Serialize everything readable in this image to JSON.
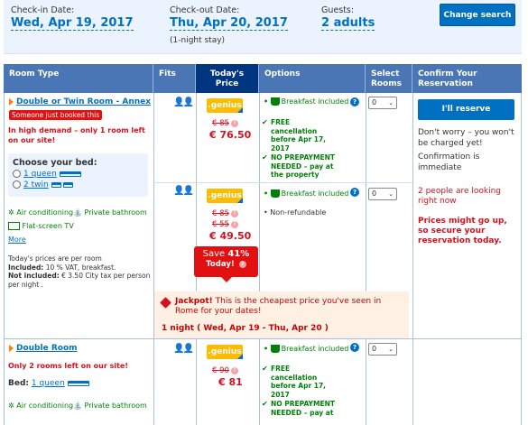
{
  "search": {
    "checkin_label": "Check-in Date:",
    "checkin_value": "Wed, Apr 19, 2017",
    "checkout_label": "Check-out Date:",
    "checkout_value": "Thu, Apr 20, 2017",
    "stay_length": "(1-night stay)",
    "guests_label": "Guests:",
    "guests_value": "2 adults",
    "change_button": "Change search"
  },
  "table_header": {
    "room_type": "Room Type",
    "fits": "Fits",
    "price_line1": "Today's",
    "price_line2": "Price",
    "options": "Options",
    "select_line1": "Select",
    "select_line2": "Rooms",
    "confirm_line1": "Confirm Your",
    "confirm_line2": "Reservation"
  },
  "room1": {
    "name": "Double or Twin Room - Annex",
    "booked_badge": "Someone just booked this",
    "demand": "In high demand – only 1 room left on our site!",
    "bed_title": "Choose your bed:",
    "bed_option1": "1 queen",
    "bed_option2": "2 twin",
    "facility_ac": "Air conditioning",
    "facility_bath": "Private bathroom",
    "facility_tv": "Flat-screen TV",
    "more_link": "More",
    "fine_line1": "Today's prices are per room",
    "included_label": "Included:",
    "included_value": "10 % VAT, breakfast.",
    "not_included_label": "Not included:",
    "not_included_value": "€ 3.50 City tax per person per night ."
  },
  "offer1": {
    "genius": ".genius",
    "old_price": "€ 85",
    "price": "€ 76.50",
    "breakfast": "Breakfast included",
    "free_cancel": "FREE cancellation before Apr 17, 2017",
    "no_prepay": "NO PREPAYMENT NEEDED – pay at the property",
    "select_value": "0"
  },
  "offer2": {
    "genius": ".genius",
    "old_price1": "€ 85",
    "old_price2": "€ 55",
    "price": "€ 49.50",
    "save_text": "Save",
    "save_pct": "41%",
    "save_today": "Today!",
    "breakfast": "Breakfast included",
    "non_refundable": "Non-refundable",
    "select_value": "0"
  },
  "confirm": {
    "reserve_button": "I'll reserve",
    "no_worry": "Don't worry – you won't be charged yet!",
    "immediate": "Confirmation is immediate",
    "looking": "2 people are looking right now",
    "prices_up": "Prices might go up, so secure your reservation today."
  },
  "jackpot": {
    "title": "Jackpot!",
    "text": "This is the cheapest price you've seen in Rome for your dates!",
    "nights": "1 night ( Wed, Apr 19 - Thu, Apr 20 )"
  },
  "room2": {
    "name": "Double Room",
    "left": "Only 2 rooms left on our site!",
    "bed_label": "Bed:",
    "bed_value": "1 queen",
    "facility_ac": "Air conditioning",
    "facility_bath": "Private bathroom"
  },
  "offer3": {
    "genius": ".genius",
    "old_price": "€ 90",
    "price": "€ 81",
    "breakfast": "Breakfast included",
    "free_cancel": "FREE cancellation before Apr 17, 2017",
    "no_prepay": "NO PREPAYMENT NEEDED – pay at",
    "select_value": "0"
  },
  "colors": {
    "brand_blue": "#003580",
    "link_blue": "#0071c2",
    "header_blue": "#4b76b5",
    "red": "#d4111e",
    "green": "#008009",
    "genius_yellow": "#febb02"
  }
}
